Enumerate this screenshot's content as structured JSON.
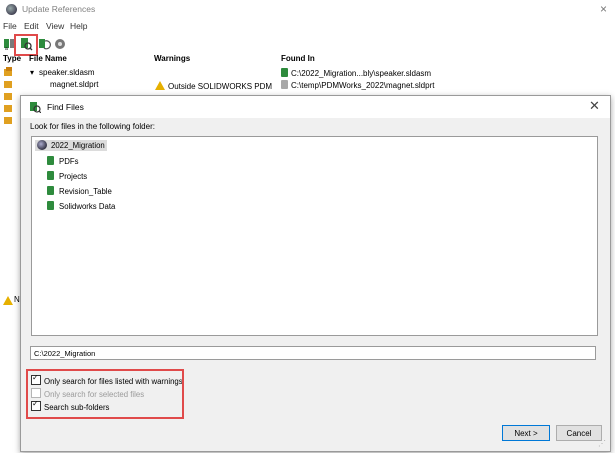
{
  "back_window": {
    "title": "Update References",
    "close_glyph": "×",
    "menu": [
      "File",
      "Edit",
      "View",
      "Help"
    ],
    "toolbar_icons": [
      "find-references-icon",
      "find-files-icon",
      "refresh-icon",
      "settings-icon"
    ],
    "columns": {
      "type": "Type",
      "file_name": "File Name",
      "warnings": "Warnings",
      "found_in": "Found In"
    },
    "rows": [
      {
        "expander": "▾",
        "file_name": "speaker.sldasm",
        "warning": "",
        "found_in": "C:\\2022_Migration...bly\\speaker.sldasm",
        "found_icon": "green-file-icon"
      },
      {
        "expander": "",
        "file_name": "magnet.sldprt",
        "warning": "Outside SOLIDWORKS PDM",
        "found_in": "C:\\temp\\PDMWorks_2022\\magnet.sldprt",
        "found_icon": "gray-file-icon"
      }
    ],
    "status_warning_letter": "N"
  },
  "dialog": {
    "title": "Find Files",
    "close_glyph": "✕",
    "folder_label": "Look for files in the following folder:",
    "tree": {
      "root": "2022_Migration",
      "children": [
        "PDFs",
        "Projects",
        "Revision_Table",
        "Solidworks Data"
      ]
    },
    "path_value": "C:\\2022_Migration",
    "options": [
      {
        "label": "Only search for files listed with warnings",
        "checked": true,
        "enabled": true
      },
      {
        "label": "Only search for selected files",
        "checked": false,
        "enabled": false
      },
      {
        "label": "Search sub-folders",
        "checked": true,
        "enabled": true
      }
    ],
    "next_label": "Next >",
    "cancel_label": "Cancel"
  },
  "colors": {
    "highlight": "#e04a4a",
    "pdm_green": "#2e8b3d",
    "warning_yellow": "#e6b000"
  }
}
